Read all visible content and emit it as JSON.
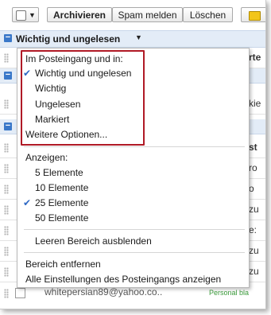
{
  "toolbar": {
    "archive_label": "Archivieren",
    "spam_label": "Spam melden",
    "delete_label": "Löschen"
  },
  "section": {
    "title": "Wichtig und ungelesen"
  },
  "rows": {
    "tail1": "rte",
    "tail2": "kie",
    "tail3": "st",
    "tail4": "ro",
    "tail5": "o",
    "tail6": "zu",
    "tail7": "e:",
    "tail8": "zu",
    "tail9": "zu",
    "bottom_text": "whitepersian89@yahoo.co..",
    "bottom_label": "Personal bla"
  },
  "menu": {
    "inbox_header": "Im Posteingang und in:",
    "items": [
      "Wichtig und ungelesen",
      "Wichtig",
      "Ungelesen",
      "Markiert"
    ],
    "more_options": "Weitere Optionen...",
    "show_header": "Anzeigen:",
    "counts": [
      "5 Elemente",
      "10 Elemente",
      "25 Elemente",
      "50 Elemente"
    ],
    "hide_empty": "Leeren Bereich ausblenden",
    "remove_section": "Bereich entfernen",
    "show_all_settings": "Alle Einstellungen des Posteingangs anzeigen",
    "check_mark": "✔"
  },
  "colors": {
    "highlight_border": "#b01a26",
    "check": "#2d68c4",
    "section_bg": "#e3ecf7"
  }
}
